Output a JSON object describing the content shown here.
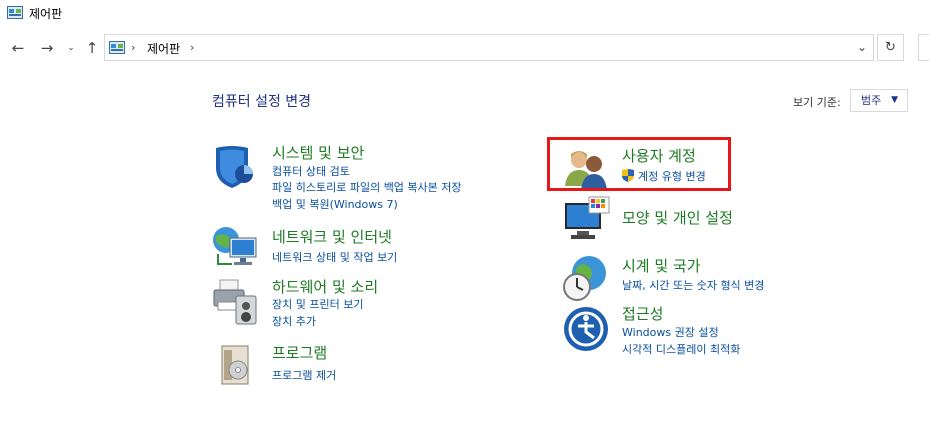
{
  "window": {
    "title": "제어판"
  },
  "address": {
    "crumb": "제어판"
  },
  "header": {
    "title": "컴퓨터 설정 변경",
    "view_by_label": "보기 기준:",
    "view_by_value": "범주"
  },
  "categories": {
    "system": {
      "title": "시스템 및 보안",
      "links": [
        "컴퓨터 상태 검토",
        "파일 히스토리로 파일의 백업 복사본 저장",
        "백업 및 복원(Windows 7)"
      ]
    },
    "network": {
      "title": "네트워크 및 인터넷",
      "links": [
        "네트워크 상태 및 작업 보기"
      ]
    },
    "hardware": {
      "title": "하드웨어 및 소리",
      "links": [
        "장치 및 프린터 보기",
        "장치 추가"
      ]
    },
    "programs": {
      "title": "프로그램",
      "links": [
        "프로그램 제거"
      ]
    },
    "users": {
      "title": "사용자 계정",
      "links": [
        "계정 유형 변경"
      ]
    },
    "appearance": {
      "title": "모양 및 개인 설정",
      "links": []
    },
    "clock": {
      "title": "시계 및 국가",
      "links": [
        "날짜, 시간 또는 숫자 형식 변경"
      ]
    },
    "access": {
      "title": "접근성",
      "links": [
        "Windows 권장 설정",
        "시각적 디스플레이 최적화"
      ]
    }
  },
  "colors": {
    "title_green": "#1e7b24",
    "link_blue": "#0a50a0",
    "highlight_red": "#e41818"
  }
}
